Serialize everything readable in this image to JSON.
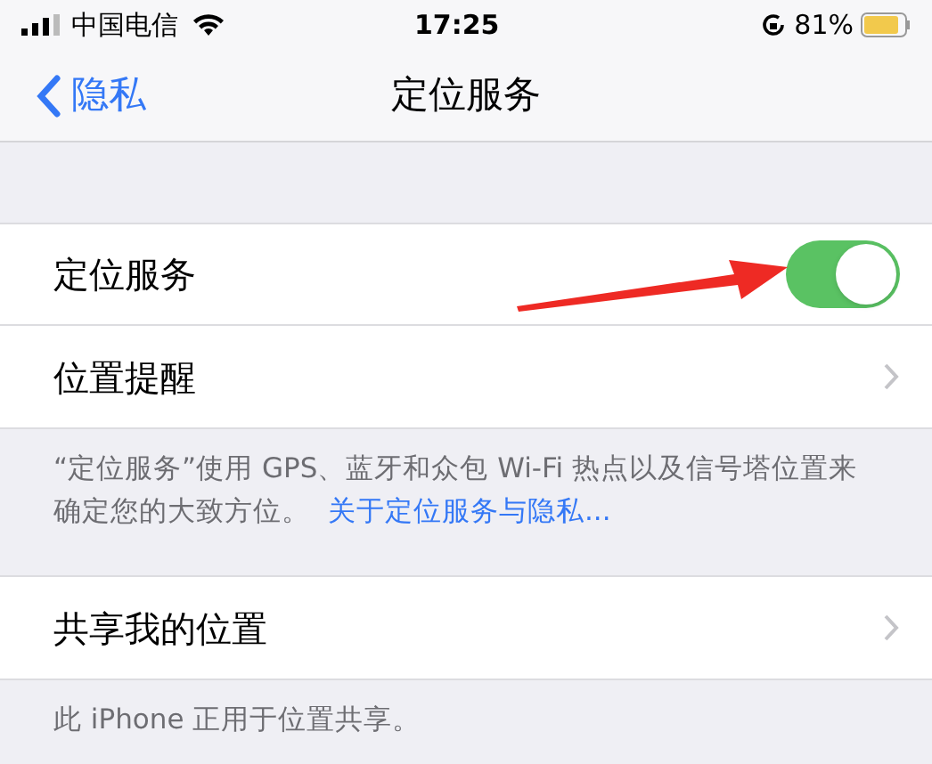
{
  "status_bar": {
    "carrier": "中国电信",
    "time": "17:25",
    "battery": "81%"
  },
  "nav": {
    "back": "隐私",
    "title": "定位服务"
  },
  "sections": [
    {
      "rows": [
        {
          "kind": "toggle",
          "label": "定位服务",
          "on": true
        },
        {
          "kind": "link",
          "label": "位置提醒"
        }
      ],
      "footer": {
        "text": "“定位服务”使用 GPS、蓝牙和众包 Wi-Fi 热点以及信号塔位置来确定您的大致方位。",
        "link": "关于定位服务与隐私..."
      }
    },
    {
      "rows": [
        {
          "kind": "link",
          "label": "共享我的位置"
        }
      ],
      "footer": {
        "text": "此 iPhone 正用于位置共享。"
      }
    }
  ]
}
